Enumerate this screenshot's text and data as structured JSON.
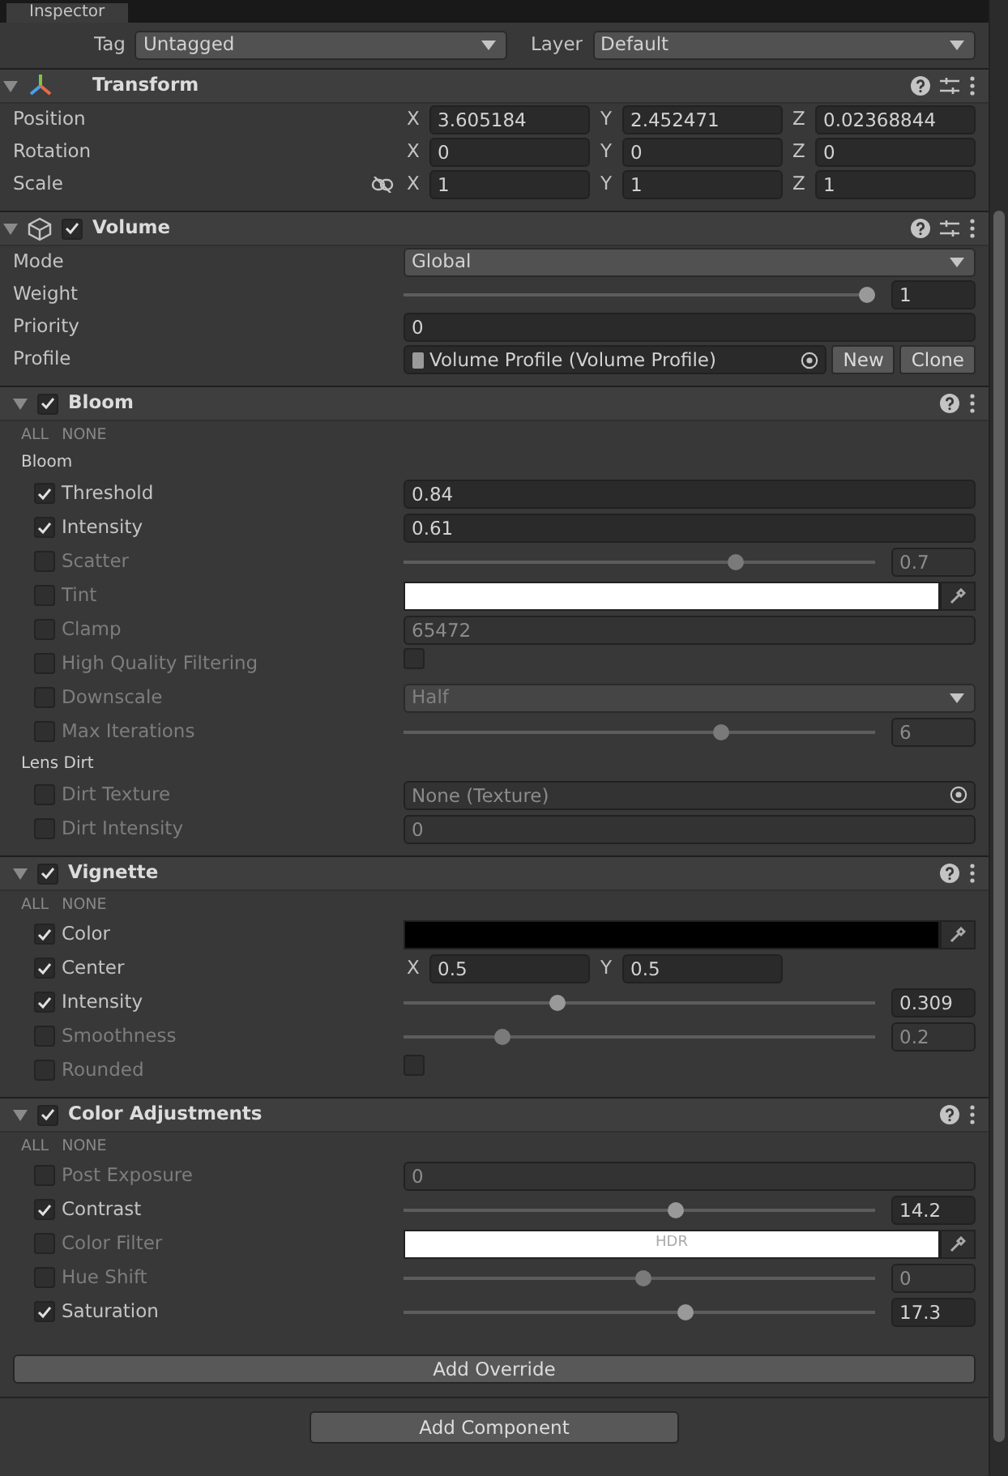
{
  "inspector_tab": {
    "title": "Inspector"
  },
  "object_header": {
    "tag_label": "Tag",
    "tag": "Untagged",
    "layer_label": "Layer",
    "layer": "Default"
  },
  "transform": {
    "title": "Transform",
    "expanded": true,
    "rows": [
      {
        "label": "Position",
        "axes": [
          {
            "axis": "X",
            "value": "3.605184"
          },
          {
            "axis": "Y",
            "value": "2.452471"
          },
          {
            "axis": "Z",
            "value": "0.02368844"
          }
        ]
      },
      {
        "label": "Rotation",
        "axes": [
          {
            "axis": "X",
            "value": "0"
          },
          {
            "axis": "Y",
            "value": "0"
          },
          {
            "axis": "Z",
            "value": "0"
          }
        ]
      },
      {
        "label": "Scale",
        "linked": false,
        "axes": [
          {
            "axis": "X",
            "value": "1"
          },
          {
            "axis": "Y",
            "value": "1"
          },
          {
            "axis": "Z",
            "value": "1"
          }
        ]
      }
    ]
  },
  "volume": {
    "title": "Volume",
    "enabled": true,
    "expanded": true,
    "fields": [
      {
        "kind": "dropdown",
        "label": "Mode",
        "value": "Global"
      },
      {
        "kind": "slider",
        "label": "Weight",
        "level": 1,
        "value": "1"
      },
      {
        "kind": "field",
        "label": "Priority",
        "value": "0"
      },
      {
        "kind": "object",
        "label": "Profile",
        "value": "Volume Profile (Volume Profile)",
        "buttons": [
          "New",
          "Clone"
        ]
      }
    ]
  },
  "overrides": [
    {
      "title": "Bloom",
      "enabled": true,
      "expanded": true,
      "all_label": "ALL",
      "none_label": "NONE",
      "items": [
        {
          "kind": "heading",
          "label": "Bloom"
        },
        {
          "kind": "field",
          "label": "Threshold",
          "overridden": true,
          "value": "0.84"
        },
        {
          "kind": "field",
          "label": "Intensity",
          "overridden": true,
          "value": "0.61"
        },
        {
          "kind": "slider",
          "label": "Scatter",
          "overridden": false,
          "level": 0.71,
          "value": "0.7"
        },
        {
          "kind": "color",
          "label": "Tint",
          "overridden": false,
          "color": "#ffffff"
        },
        {
          "kind": "field",
          "label": "Clamp",
          "overridden": false,
          "value": "65472"
        },
        {
          "kind": "toggle",
          "label": "High Quality Filtering",
          "overridden": false,
          "checked": false
        },
        {
          "kind": "dropdown",
          "label": "Downscale",
          "overridden": false,
          "value": "Half"
        },
        {
          "kind": "slider",
          "label": "Max Iterations",
          "overridden": false,
          "level": 0.68,
          "value": "6"
        },
        {
          "kind": "heading",
          "label": "Lens Dirt"
        },
        {
          "kind": "object",
          "label": "Dirt Texture",
          "overridden": false,
          "value": "None (Texture)"
        },
        {
          "kind": "field",
          "label": "Dirt Intensity",
          "overridden": false,
          "value": "0"
        }
      ]
    },
    {
      "title": "Vignette",
      "enabled": true,
      "expanded": true,
      "all_label": "ALL",
      "none_label": "NONE",
      "items": [
        {
          "kind": "color",
          "label": "Color",
          "overridden": true,
          "color": "#000000"
        },
        {
          "kind": "vector2",
          "label": "Center",
          "overridden": true,
          "axes": [
            {
              "axis": "X",
              "value": "0.5"
            },
            {
              "axis": "Y",
              "value": "0.5"
            }
          ]
        },
        {
          "kind": "slider",
          "label": "Intensity",
          "overridden": true,
          "level": 0.32,
          "value": "0.309"
        },
        {
          "kind": "slider",
          "label": "Smoothness",
          "overridden": false,
          "level": 0.2,
          "value": "0.2"
        },
        {
          "kind": "toggle",
          "label": "Rounded",
          "overridden": false,
          "checked": false
        }
      ]
    },
    {
      "title": "Color Adjustments",
      "enabled": true,
      "expanded": true,
      "all_label": "ALL",
      "none_label": "NONE",
      "items": [
        {
          "kind": "field",
          "label": "Post Exposure",
          "overridden": false,
          "value": "0"
        },
        {
          "kind": "slider",
          "label": "Contrast",
          "overridden": true,
          "level": 0.58,
          "value": "14.2"
        },
        {
          "kind": "color",
          "label": "Color Filter",
          "overridden": false,
          "color": "#ffffff",
          "badge": "HDR"
        },
        {
          "kind": "slider",
          "label": "Hue Shift",
          "overridden": false,
          "level": 0.51,
          "value": "0"
        },
        {
          "kind": "slider",
          "label": "Saturation",
          "overridden": true,
          "level": 0.6,
          "value": "17.3"
        }
      ]
    }
  ],
  "add_override": "Add Override",
  "add_component": "Add Component"
}
